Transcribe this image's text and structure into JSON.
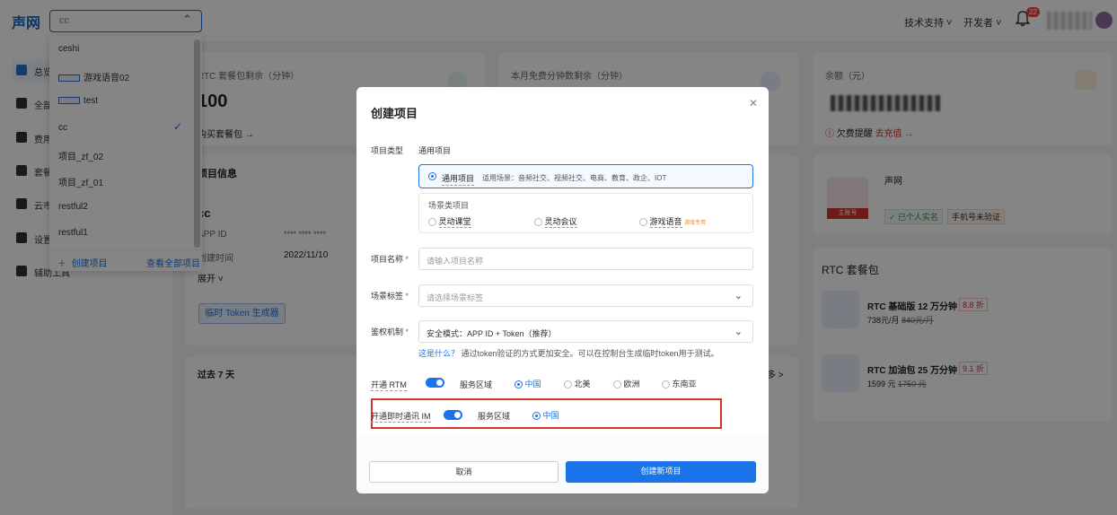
{
  "header": {
    "logo": "声网",
    "project_select_value": "cc",
    "support": "技术支持",
    "developer": "开发者",
    "notification_count": "22"
  },
  "sidebar": {
    "items": [
      {
        "label": "总览"
      },
      {
        "label": "全部"
      },
      {
        "label": "费用"
      },
      {
        "label": "套餐"
      },
      {
        "label": "云市"
      },
      {
        "label": "设置"
      },
      {
        "label": "辅助工具"
      }
    ]
  },
  "project_dropdown": {
    "items": [
      {
        "label": "ceshi",
        "tag": false,
        "selected": false
      },
      {
        "label": "游戏语音02",
        "tag": true,
        "selected": false
      },
      {
        "label": "test",
        "tag": true,
        "selected": false
      },
      {
        "label": "cc",
        "tag": false,
        "selected": true
      },
      {
        "label": "项目_zf_02",
        "tag": false,
        "selected": false
      },
      {
        "label": "项目_zf_01",
        "tag": false,
        "selected": false
      },
      {
        "label": "restful2",
        "tag": false,
        "selected": false
      },
      {
        "label": "restful1",
        "tag": false,
        "selected": false
      }
    ],
    "create_label": "创建项目",
    "view_all_label": "查看全部项目"
  },
  "dashboard": {
    "rtc_card_title": "RTC 套餐包剩余（分钟）",
    "rtc_value": "100",
    "buy_link": "购买套餐包 →",
    "free_card_title": "本月免费分钟数剩余（分钟）",
    "balance_title": "余额（元）",
    "arrears": "欠费提醒",
    "recharge": "去充值 →",
    "project_info_title": "项目信息",
    "project_name": "cc",
    "app_id_label": "APP ID",
    "app_id_value": "**** **** ****",
    "created_label": "创建时间",
    "created_value": "2022/11/10",
    "expand": "展开",
    "token_btn": "临时 Token 生成器",
    "past7": "过去 7 天",
    "more": "多 >",
    "account_name": "声网",
    "master_tag": "主账号",
    "verified": "已个人实名",
    "phone_unverified": "手机号未验证",
    "rtc_pkg_title": "RTC 套餐包",
    "pkg1_name": "RTC 基础版 12 万分钟",
    "pkg1_discount": "8.8 折",
    "pkg1_price": "738元/月",
    "pkg1_orig": "840元/月",
    "pkg2_name": "RTC 加油包 25 万分钟",
    "pkg2_discount": "9.1 折",
    "pkg2_price": "1599 元",
    "pkg2_orig": "1750 元"
  },
  "modal": {
    "title": "创建项目",
    "type_label": "项目类型",
    "type_value": "通用项目",
    "general_option": "通用项目",
    "general_desc": "适用场景：音频社交、视频社交、电商、教育、政企、IOT",
    "scene_title": "场景类项目",
    "scene_options": [
      "灵动课堂",
      "灵动会议",
      "游戏语音"
    ],
    "game_tag": "游戏专用",
    "name_label": "项目名称",
    "name_placeholder": "请输入项目名称",
    "tag_label": "场景标签",
    "tag_placeholder": "请选择场景标签",
    "auth_label": "鉴权机制",
    "auth_value": "安全模式：APP ID + Token（推荐）",
    "auth_what": "这是什么？",
    "auth_hint": "通过token验证的方式更加安全。可以在控制台生成临时token用于测试。",
    "rtm_label": "开通 RTM",
    "region_label": "服务区域",
    "rtm_regions": [
      "中国",
      "北美",
      "欧洲",
      "东南亚"
    ],
    "im_label": "开通即时通讯 IM",
    "im_region_label": "服务区域",
    "im_region": "中国",
    "cancel": "取消",
    "create": "创建新项目"
  }
}
